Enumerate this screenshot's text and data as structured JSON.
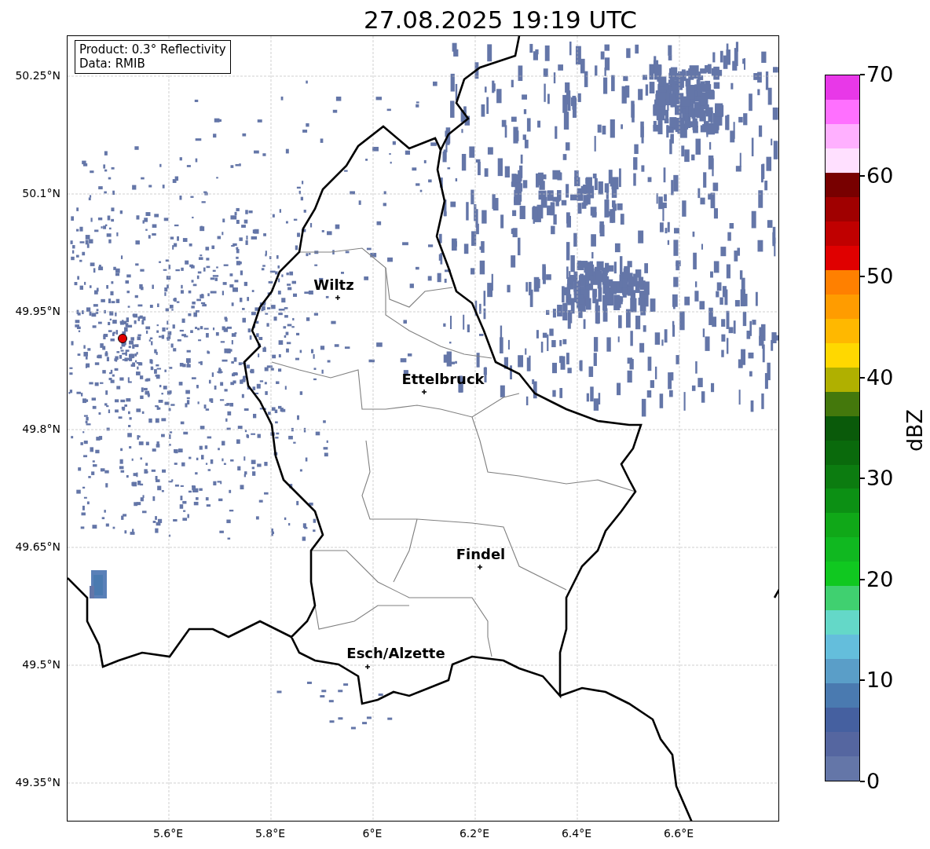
{
  "title": "27.08.2025 19:19 UTC",
  "map": {
    "info_box": [
      "Product: 0.3° Reflectivity",
      "Data: RMIB"
    ],
    "cities": [
      {
        "name": "Wiltz"
      },
      {
        "name": "Ettelbruck"
      },
      {
        "name": "Findel"
      },
      {
        "name": "Esch/Alzette"
      }
    ],
    "lat_ticks": [
      "50.25°N",
      "50.1°N",
      "49.95°N",
      "49.8°N",
      "49.65°N",
      "49.5°N",
      "49.35°N"
    ],
    "lon_ticks": [
      "5.6°E",
      "5.8°E",
      "6°E",
      "6.2°E",
      "6.4°E",
      "6.6°E"
    ]
  },
  "colorbar": {
    "label": "dBZ",
    "ticks": [
      "70",
      "60",
      "50",
      "40",
      "30",
      "20",
      "10",
      "0"
    ],
    "segments": [
      {
        "color": "#e838e8"
      },
      {
        "color": "#ff70ff"
      },
      {
        "color": "#ffb0ff"
      },
      {
        "color": "#ffe0ff"
      },
      {
        "color": "#780000"
      },
      {
        "color": "#a00000"
      },
      {
        "color": "#c00000"
      },
      {
        "color": "#e00000"
      },
      {
        "color": "#ff8000"
      },
      {
        "color": "#ff9c00"
      },
      {
        "color": "#ffb800"
      },
      {
        "color": "#ffd800"
      },
      {
        "color": "#b0b000"
      },
      {
        "color": "#44780c"
      },
      {
        "color": "#0a5a0a"
      },
      {
        "color": "#0a6a0c"
      },
      {
        "color": "#0c7c10"
      },
      {
        "color": "#0c9014"
      },
      {
        "color": "#10a818"
      },
      {
        "color": "#10b820"
      },
      {
        "color": "#10c820"
      },
      {
        "color": "#40d070"
      },
      {
        "color": "#64d8c8"
      },
      {
        "color": "#64bedc"
      },
      {
        "color": "#5a9ec8"
      },
      {
        "color": "#4a7ab0"
      },
      {
        "color": "#4560a0"
      },
      {
        "color": "#5566a0"
      },
      {
        "color": "#6476a8"
      }
    ]
  }
}
